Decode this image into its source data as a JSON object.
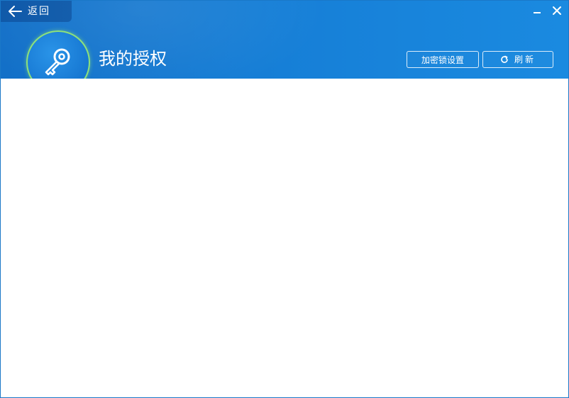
{
  "header": {
    "back_label": "返回",
    "title": "我的授权",
    "lock_settings_label": "加密锁设置",
    "refresh_label": "刷新",
    "minimize_glyph": "–",
    "close_glyph": "✕"
  },
  "icons": {
    "back": "arrow-left-icon",
    "avatar": "key-icon",
    "refresh": "refresh-icon",
    "minimize": "minimize-icon",
    "close": "close-icon"
  },
  "colors": {
    "header_blue": "#1676d2",
    "avatar_ring": "#8ee27a",
    "text_white": "#ffffff",
    "window_border": "#1a78c8"
  }
}
